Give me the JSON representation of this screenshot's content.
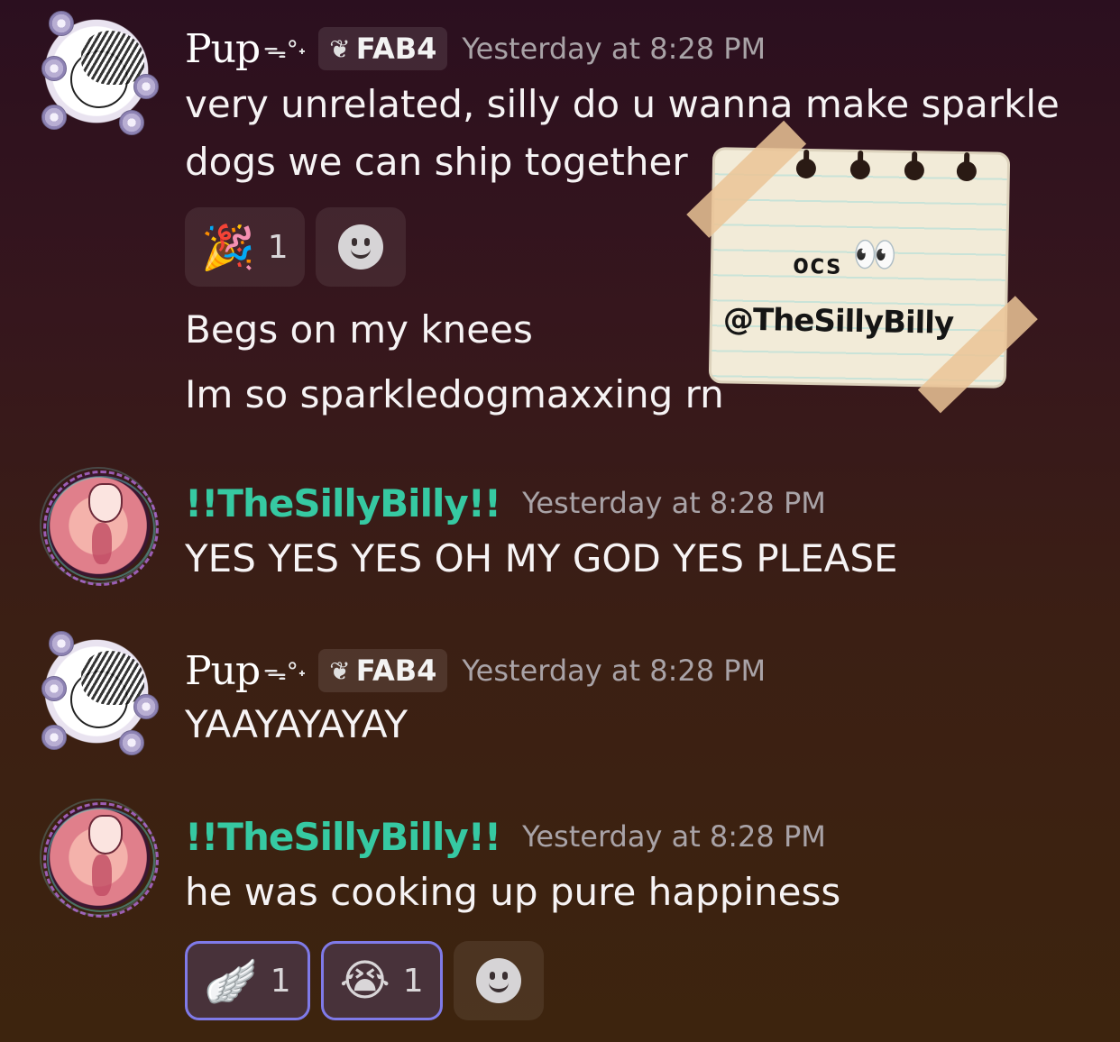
{
  "messages": [
    {
      "author": "Pup",
      "author_deco": "ᯓ°˖",
      "tag": "FAB4",
      "timestamp": "Yesterday at 8:28 PM",
      "lines": [
        "very unrelated, silly do u wanna make sparkle",
        "dogs we can ship together"
      ],
      "reactions": [
        {
          "emoji": "🎉",
          "count": "1"
        }
      ],
      "followups": [
        "Begs on my knees",
        "Im so sparkledogmaxxing rn"
      ]
    },
    {
      "author": "!!TheSillyBilly!!",
      "timestamp": "Yesterday at 8:28 PM",
      "lines": [
        "YES YES YES OH MY GOD YES PLEASE"
      ]
    },
    {
      "author": "Pup",
      "author_deco": "ᯓ°˖",
      "tag": "FAB4",
      "timestamp": "Yesterday at 8:28 PM",
      "lines": [
        "YAAYAYAYAY"
      ]
    },
    {
      "author": "!!TheSillyBilly!!",
      "timestamp": "Yesterday at 8:28 PM",
      "lines": [
        "he was cooking up pure happiness"
      ],
      "reactions": [
        {
          "emoji": "🪽",
          "count": "1"
        },
        {
          "emoji": "😭",
          "count": "1"
        }
      ]
    }
  ],
  "sticker": {
    "line1": "ocs",
    "eyes": "👀",
    "line2": "@TheSillyBilly"
  },
  "colors": {
    "billy_name": "#36c9a2",
    "reaction_border": "#7f7ae8"
  },
  "icons": {
    "tag": "leaf-icon",
    "add_reaction": "smile-add-reaction-icon"
  }
}
